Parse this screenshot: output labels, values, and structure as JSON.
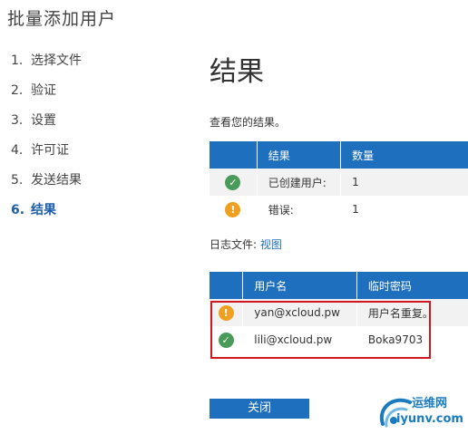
{
  "header": {
    "title": "批量添加用户"
  },
  "steps": [
    {
      "num": "1.",
      "label": "选择文件"
    },
    {
      "num": "2.",
      "label": "验证"
    },
    {
      "num": "3.",
      "label": "设置"
    },
    {
      "num": "4.",
      "label": "许可证"
    },
    {
      "num": "5.",
      "label": "发送结果"
    },
    {
      "num": "6.",
      "label": "结果",
      "active": true
    }
  ],
  "main": {
    "title": "结果",
    "description": "查看您的结果。",
    "results_table": {
      "headers": [
        "",
        "结果",
        "数量"
      ],
      "rows": [
        {
          "icon": "check-icon",
          "status": "success",
          "label": "已创建用户:",
          "count": "1"
        },
        {
          "icon": "warning-icon",
          "status": "error",
          "label": "错误:",
          "count": "1"
        }
      ]
    },
    "log": {
      "label": "日志文件:",
      "link": "视图"
    },
    "users_table": {
      "headers": [
        "",
        "用户名",
        "临时密码"
      ],
      "rows": [
        {
          "icon": "warning-icon",
          "status": "error",
          "username": "yan@xcloud.pw",
          "password": "用户名重复。"
        },
        {
          "icon": "check-icon",
          "status": "success",
          "username": "lili@xcloud.pw",
          "password": "Boka9703"
        }
      ]
    },
    "close_label": "关闭"
  },
  "watermark": {
    "line1": "运维网",
    "line2": "iyunv.com"
  },
  "colors": {
    "accent": "#1f6fbf",
    "success": "#4a9a5a",
    "warning": "#f0a020",
    "highlight": "#d0161f"
  }
}
